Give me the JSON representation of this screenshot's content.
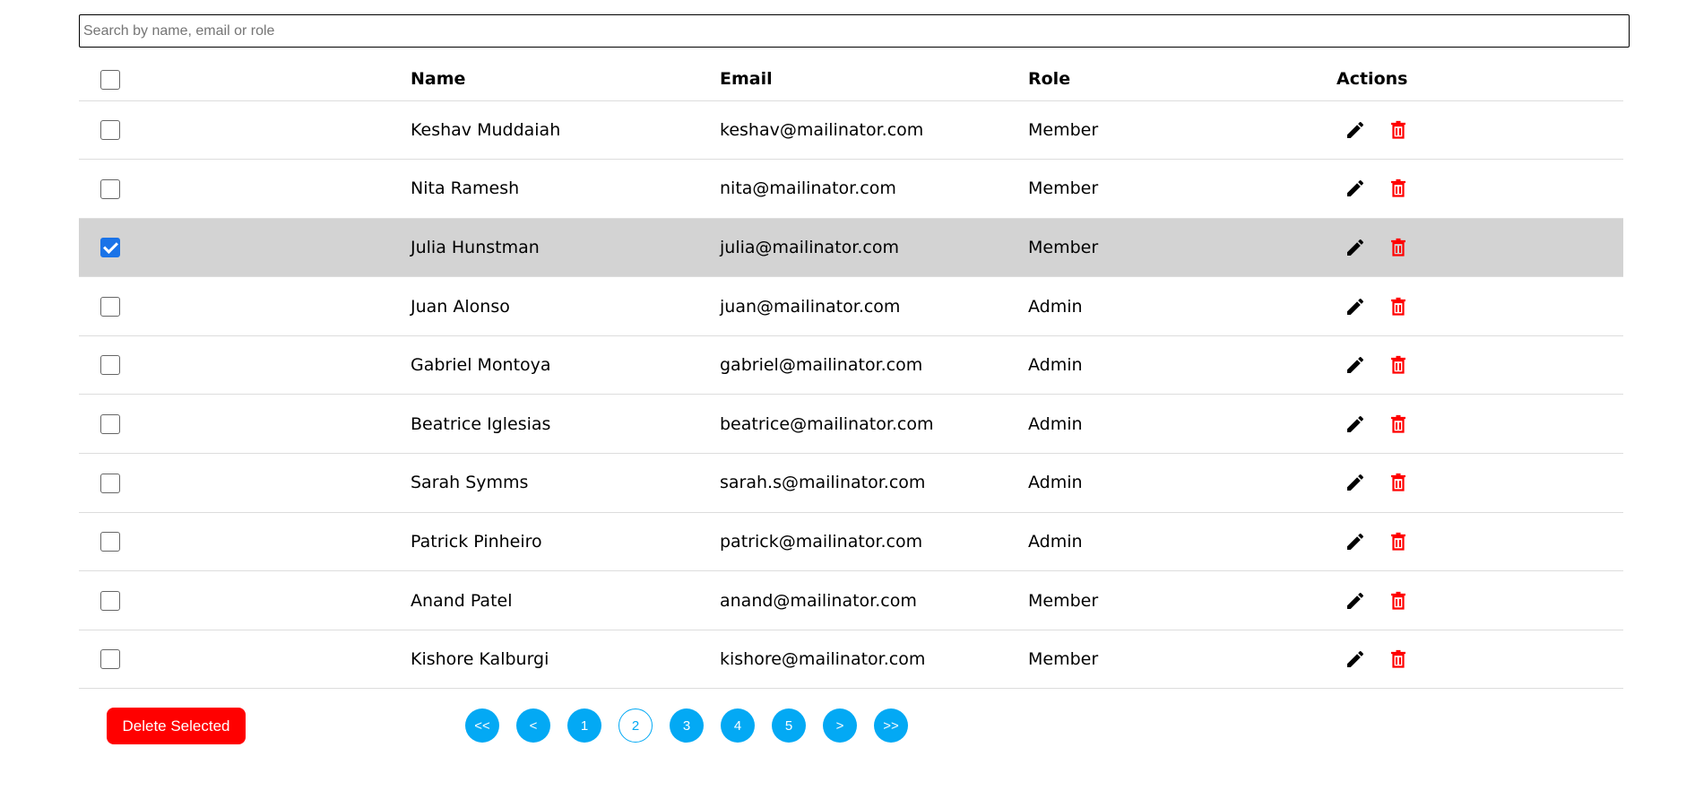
{
  "search": {
    "placeholder": "Search by name, email or role",
    "value": ""
  },
  "table": {
    "headers": {
      "name": "Name",
      "email": "Email",
      "role": "Role",
      "actions": "Actions"
    },
    "rows": [
      {
        "name": "Keshav Muddaiah",
        "email": "keshav@mailinator.com",
        "role": "Member",
        "checked": false
      },
      {
        "name": "Nita Ramesh",
        "email": "nita@mailinator.com",
        "role": "Member",
        "checked": false
      },
      {
        "name": "Julia Hunstman",
        "email": "julia@mailinator.com",
        "role": "Member",
        "checked": true
      },
      {
        "name": "Juan Alonso",
        "email": "juan@mailinator.com",
        "role": "Admin",
        "checked": false
      },
      {
        "name": "Gabriel Montoya",
        "email": "gabriel@mailinator.com",
        "role": "Admin",
        "checked": false
      },
      {
        "name": "Beatrice Iglesias",
        "email": "beatrice@mailinator.com",
        "role": "Admin",
        "checked": false
      },
      {
        "name": "Sarah Symms",
        "email": "sarah.s@mailinator.com",
        "role": "Admin",
        "checked": false
      },
      {
        "name": "Patrick Pinheiro",
        "email": "patrick@mailinator.com",
        "role": "Admin",
        "checked": false
      },
      {
        "name": "Anand Patel",
        "email": "anand@mailinator.com",
        "role": "Member",
        "checked": false
      },
      {
        "name": "Kishore Kalburgi",
        "email": "kishore@mailinator.com",
        "role": "Member",
        "checked": false
      }
    ]
  },
  "footer": {
    "delete_label": "Delete Selected",
    "pagination": {
      "first": "<<",
      "prev": "<",
      "pages": [
        "1",
        "2",
        "3",
        "4",
        "5"
      ],
      "current": "2",
      "next": ">",
      "last": ">>"
    }
  },
  "icons": {
    "edit": "pencil-icon",
    "delete": "trash-icon"
  },
  "colors": {
    "delete": "#ff0000",
    "page_button": "#03a9f4",
    "selected_row": "#d3d3d3",
    "checkbox_checked": "#1a73e8"
  }
}
